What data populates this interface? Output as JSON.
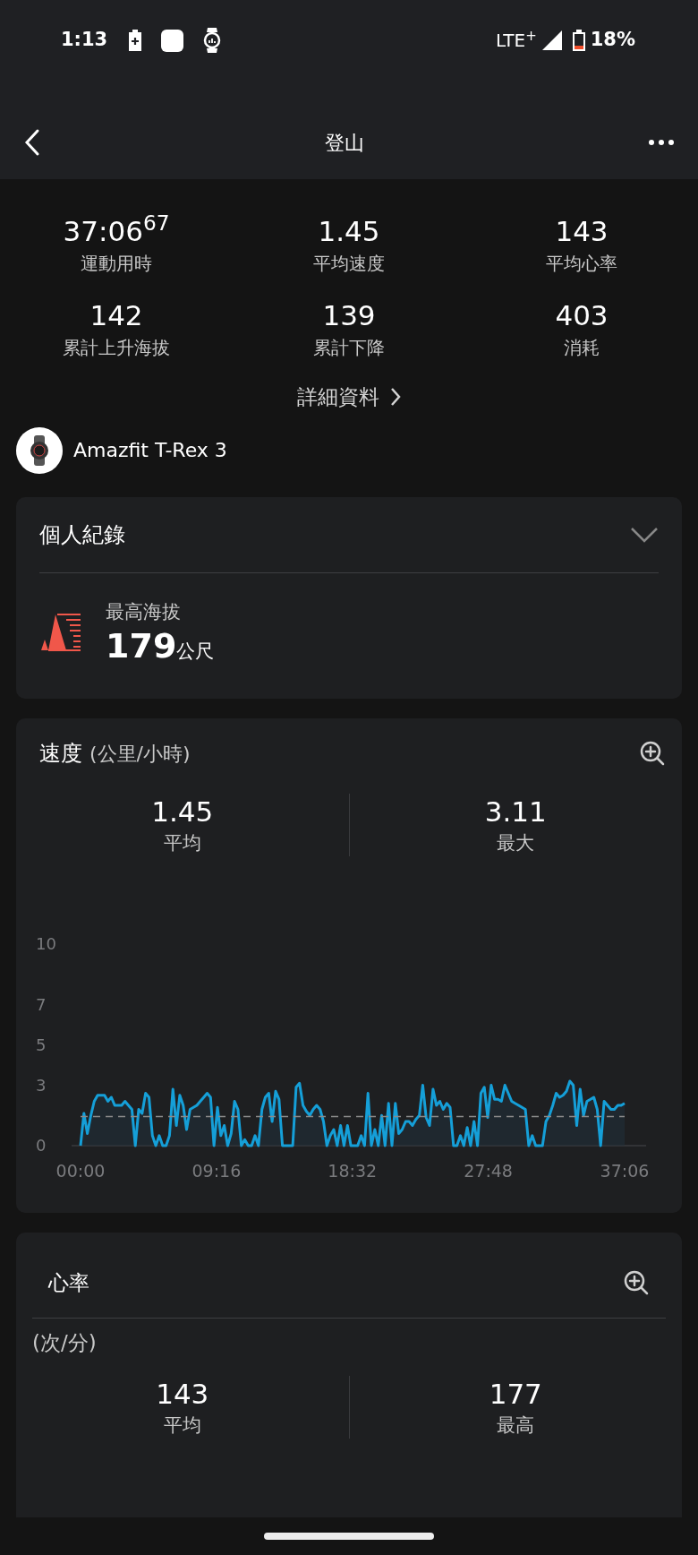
{
  "status_bar": {
    "time": "1:13",
    "network": "LTE$^{+}$",
    "battery": "18%"
  },
  "header": {
    "title": "登山"
  },
  "summary": [
    {
      "value": "37:06$^{67}$",
      "label": "運動用時"
    },
    {
      "value": "1.45",
      "label": "平均速度"
    },
    {
      "value": "143",
      "label": "平均心率"
    },
    {
      "value": "142",
      "label": "累計上升海拔"
    },
    {
      "value": "139",
      "label": "累計下降"
    },
    {
      "value": "403",
      "label": "消耗"
    }
  ],
  "details_link": "詳細資料",
  "device": {
    "name": "Amazfit T-Rex 3"
  },
  "records": {
    "title": "個人紀錄",
    "expanded": false,
    "items": [
      {
        "label": "最高海拔",
        "value": "179",
        "unit": "公尺"
      }
    ]
  },
  "speed": {
    "title": "速度",
    "unit": "(公里/小時)",
    "stats": [
      {
        "value": "1.45",
        "label": "平均"
      },
      {
        "value": "3.11",
        "label": "最大"
      }
    ],
    "chart_data": {
      "type": "area",
      "xlim": [
        0,
        2226
      ],
      "ylim": [
        0,
        10
      ],
      "yticks": [
        0,
        3,
        5,
        7,
        10
      ],
      "xticks": [
        {
          "value": 0,
          "label": "00:00"
        },
        {
          "value": 556,
          "label": "09:16"
        },
        {
          "value": 1112,
          "label": "18:32"
        },
        {
          "value": 1668,
          "label": "27:48"
        },
        {
          "value": 2226,
          "label": "37:06"
        }
      ],
      "ref_lines": [
        {
          "axis": "y",
          "value": 1.45
        }
      ],
      "x": [
        0,
        14,
        28,
        42,
        56,
        70,
        84,
        98,
        112,
        126,
        140,
        154,
        168,
        182,
        196,
        210,
        224,
        238,
        252,
        266,
        280,
        294,
        308,
        322,
        336,
        350,
        364,
        378,
        392,
        406,
        420,
        434,
        448,
        462,
        476,
        490,
        504,
        518,
        532,
        546,
        560,
        574,
        588,
        602,
        616,
        630,
        644,
        658,
        672,
        686,
        700,
        714,
        728,
        742,
        756,
        770,
        784,
        798,
        812,
        826,
        840,
        854,
        868,
        882,
        896,
        910,
        924,
        938,
        952,
        966,
        980,
        994,
        1008,
        1022,
        1036,
        1050,
        1064,
        1078,
        1092,
        1106,
        1120,
        1134,
        1148,
        1162,
        1176,
        1190,
        1204,
        1218,
        1232,
        1246,
        1260,
        1274,
        1288,
        1302,
        1316,
        1330,
        1344,
        1358,
        1372,
        1386,
        1400,
        1414,
        1428,
        1442,
        1456,
        1470,
        1484,
        1498,
        1512,
        1526,
        1540,
        1554,
        1568,
        1582,
        1596,
        1610,
        1624,
        1638,
        1652,
        1666,
        1680,
        1694,
        1708,
        1722,
        1736,
        1750,
        1764,
        1778,
        1792,
        1806,
        1820,
        1834,
        1848,
        1862,
        1876,
        1890,
        1904,
        1918,
        1932,
        1946,
        1960,
        1974,
        1988,
        2002,
        2016,
        2030,
        2044,
        2058,
        2072,
        2086,
        2100,
        2114,
        2128,
        2142,
        2156,
        2170,
        2184,
        2198,
        2212,
        2226
      ],
      "series": [
        {
          "color": "#159fd8",
          "values": [
            0,
            1.6,
            0.6,
            1.5,
            2.2,
            2.5,
            2.5,
            2.5,
            2.2,
            2.4,
            2.0,
            2.0,
            2.0,
            2.2,
            2.0,
            1.8,
            0,
            1.8,
            1.6,
            2.6,
            2.4,
            0.5,
            0,
            0.5,
            0,
            0,
            0.5,
            2.8,
            1.0,
            2.5,
            2.0,
            0.8,
            1.8,
            1.9,
            2.0,
            2.2,
            2.4,
            2.6,
            2.4,
            0,
            1.9,
            0.5,
            1.0,
            0,
            0.6,
            2.2,
            1.8,
            0,
            0.3,
            0,
            0,
            0.5,
            0,
            1.8,
            2.4,
            2.6,
            1.2,
            2.7,
            2.3,
            0,
            0,
            0,
            0,
            2.9,
            3.1,
            2.0,
            1.7,
            1.5,
            1.8,
            2.0,
            1.8,
            1.2,
            0,
            0.5,
            0.8,
            0,
            1.0,
            0,
            1.0,
            0,
            0,
            0,
            0.5,
            0,
            2.6,
            0,
            0.8,
            0,
            1.5,
            0,
            2.1,
            0,
            2.1,
            0.6,
            0.8,
            1.2,
            1.2,
            1.0,
            1.3,
            1.5,
            3.0,
            1.4,
            1.0,
            2.8,
            2.0,
            2.2,
            1.8,
            2.1,
            1.9,
            0,
            0,
            0.5,
            0,
            0.9,
            0,
            1.2,
            0,
            2.6,
            2.9,
            1.4,
            3.0,
            2.3,
            2.3,
            2.2,
            3.0,
            2.6,
            2.2,
            2.1,
            2.0,
            1.9,
            1.8,
            0,
            0.5,
            0,
            0,
            0,
            1.2,
            1.5,
            2.0,
            2.6,
            2.4,
            2.5,
            2.7,
            3.2,
            3.0,
            1.0,
            2.8,
            1.5,
            2.2,
            2.3,
            2.4,
            1.8,
            0,
            2.2,
            2.0,
            1.8,
            1.8,
            2.0,
            2.0,
            2.1
          ]
        }
      ]
    }
  },
  "heart_rate": {
    "title": "心率",
    "unit": "(次/分)",
    "stats": [
      {
        "value": "143",
        "label": "平均"
      },
      {
        "value": "177",
        "label": "最高"
      }
    ]
  }
}
